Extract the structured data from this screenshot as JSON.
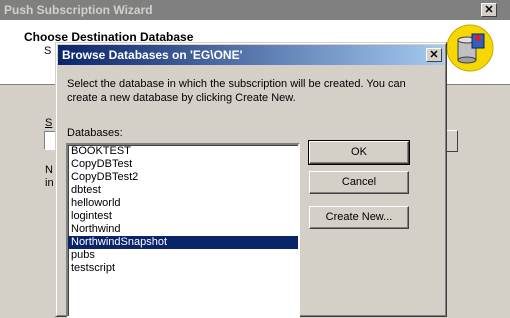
{
  "wizard": {
    "title": "Push Subscription Wizard",
    "close_glyph": "✕",
    "heading": "Choose Destination Database",
    "subtitle_fragment": "S",
    "field_label_fragment": "S",
    "text_fragment_1": "N",
    "text_fragment_2": "in",
    "icon": "database-wizard-icon"
  },
  "dialog": {
    "title": "Browse Databases on 'EG\\ONE'",
    "close_glyph": "✕",
    "instructions": "Select the database in which the subscription will be created. You can create a new database by clicking Create New.",
    "list_label": "Databases:",
    "databases": [
      "BOOKTEST",
      "CopyDBTest",
      "CopyDBTest2",
      "dbtest",
      "helloworld",
      "logintest",
      "Northwind",
      "NorthwindSnapshot",
      "pubs",
      "testscript"
    ],
    "selected": "NorthwindSnapshot",
    "buttons": {
      "ok": "OK",
      "cancel": "Cancel",
      "create_new": "Create New..."
    }
  },
  "colors": {
    "active_title": "#0a246a",
    "inactive_title": "#808080",
    "face": "#d4d0c8",
    "selection": "#0a246a"
  }
}
